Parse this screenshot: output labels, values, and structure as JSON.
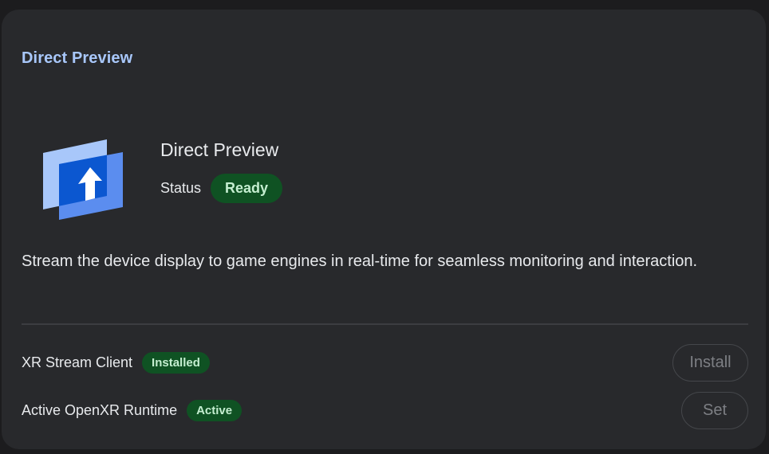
{
  "section": {
    "title": "Direct Preview"
  },
  "app": {
    "name": "Direct Preview",
    "icon": "direct-preview-upload-icon",
    "status_label": "Status",
    "status_value": "Ready",
    "description": "Stream the device display to game engines in real-time for seamless monitoring and interaction."
  },
  "dependencies": [
    {
      "label": "XR Stream Client",
      "badge": "Installed",
      "action": "Install"
    },
    {
      "label": "Active OpenXR Runtime",
      "badge": "Active",
      "action": "Set"
    }
  ],
  "colors": {
    "accent": "#a8c7fa",
    "card_background": "#28292c",
    "status_success_bg": "#0f5223",
    "status_success_text": "#c4eed0"
  }
}
